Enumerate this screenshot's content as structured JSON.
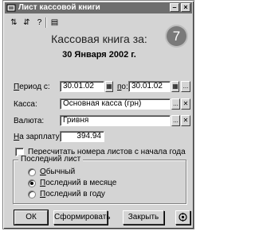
{
  "window": {
    "title": "Лист кассовой книги",
    "minimize_glyph": "–",
    "close_glyph": "×"
  },
  "toolbar": {
    "icons": [
      "sort-asc-icon",
      "sort-desc-icon",
      "help-icon",
      "print-icon"
    ],
    "glyphs": [
      "⇅",
      "⇵",
      "?",
      "▤"
    ]
  },
  "header": {
    "title": "Кассовая книга за:",
    "date": "30 Января 2002 г.",
    "badge": "7"
  },
  "form": {
    "period_label": "Период с:",
    "period_from": "30.01.02",
    "period_to_label": "по:",
    "period_to": "30.01.02",
    "kassa_label": "Касса:",
    "kassa_value": "Основная касса (грн)",
    "currency_label": "Валюта:",
    "currency_value": "Гривня",
    "salary_label": "На зарплату:",
    "salary_value": "394.94",
    "recount_label": "Пересчитать номера листов с начала года",
    "recount_checked": false,
    "ellipsis": "...",
    "clear": "✕",
    "calendar": "▦"
  },
  "last_sheet": {
    "title": "Последний лист",
    "options": [
      "Обычный",
      "Последний в месяце",
      "Последний в году"
    ],
    "selected_index": 1
  },
  "buttons": {
    "ok": "ОК",
    "form": "Сформировать",
    "close": "Закрыть",
    "extra_icon": "settings-icon"
  }
}
